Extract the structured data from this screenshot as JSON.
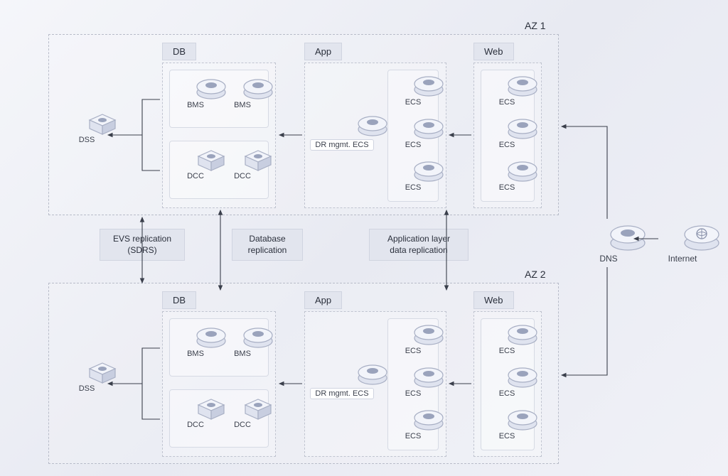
{
  "zones": {
    "az1": "AZ 1",
    "az2": "AZ 2"
  },
  "sections": {
    "db": "DB",
    "app": "App",
    "web": "Web"
  },
  "nodes": {
    "dss": "DSS",
    "bms": "BMS",
    "dcc": "DCC",
    "ecs": "ECS",
    "dr_mgmt_ecs": "DR mgmt. ECS",
    "dns": "DNS",
    "internet": "Internet"
  },
  "replication": {
    "evs": "EVS replication\n(SDRS)",
    "database": "Database\nreplication",
    "app_layer": "Application layer\ndata replication"
  },
  "colors": {
    "border_dash": "#b8bcc9",
    "label_bg": "#e2e5ee",
    "icon_stroke": "#a8afc4"
  }
}
